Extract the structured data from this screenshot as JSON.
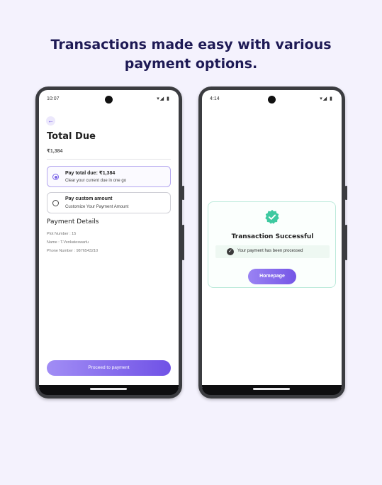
{
  "headline": {
    "line1": "Transactions made easy with various",
    "line2": "payment options."
  },
  "left_phone": {
    "status_time": "10:07",
    "status_icons": "▾◢ ▮",
    "back_icon": "arrow-left-icon",
    "title": "Total Due",
    "amount": "₹1,384",
    "options": [
      {
        "title": "Pay total due: ₹1,384",
        "subtitle": "Clear your current due in one go",
        "selected": true
      },
      {
        "title": "Pay custom amount",
        "subtitle": "Customize Your Payment Amount",
        "selected": false
      }
    ],
    "details_title": "Payment Details",
    "details": [
      "Plot Number : 15",
      "Name : T.Venkateswarlu",
      "Phone Number : 9876543210"
    ],
    "proceed_label": "Proceed to payment"
  },
  "right_phone": {
    "status_time": "4:14",
    "status_icons": "▾◢ ▮",
    "success_title": "Transaction Successful",
    "success_message": "Your payment has been processed",
    "homepage_label": "Homepage",
    "badge_icon": "verified-check-icon"
  },
  "colors": {
    "background": "#f4f2fd",
    "headline": "#1e1a55",
    "accent": "#7052e6",
    "success": "#3ec9a0"
  }
}
